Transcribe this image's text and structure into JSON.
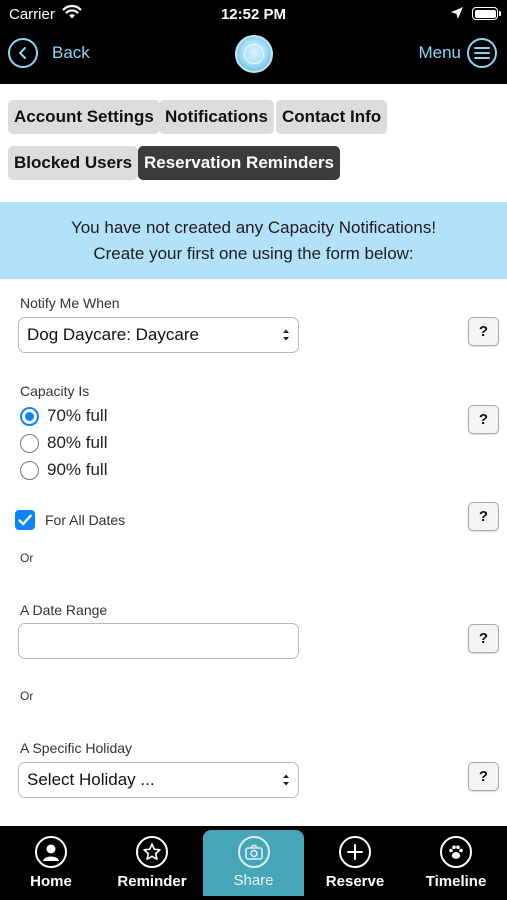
{
  "status_bar": {
    "carrier": "Carrier",
    "time": "12:52 PM"
  },
  "nav": {
    "back_label": "Back",
    "menu_label": "Menu"
  },
  "tabs": [
    {
      "label": "Account Settings",
      "active": false
    },
    {
      "label": "Notifications",
      "active": false
    },
    {
      "label": "Contact Info",
      "active": false
    },
    {
      "label": "Blocked Users",
      "active": false
    },
    {
      "label": "Reservation Reminders",
      "active": true
    }
  ],
  "banner": {
    "line1": "You have not created any Capacity Notifications!",
    "line2": "Create your first one using the form below:"
  },
  "form": {
    "notify_label": "Notify Me When",
    "notify_value": "Dog Daycare: Daycare",
    "capacity_label": "Capacity Is",
    "capacity_options": [
      {
        "label": "70% full",
        "selected": true
      },
      {
        "label": "80% full",
        "selected": false
      },
      {
        "label": "90% full",
        "selected": false
      }
    ],
    "all_dates_label": "For All Dates",
    "all_dates_checked": true,
    "or_1": "Or",
    "date_range_label": "A Date Range",
    "date_range_value": "",
    "or_2": "Or",
    "holiday_label": "A Specific Holiday",
    "holiday_value": "Select Holiday ...",
    "help_label": "?"
  },
  "bottom_nav": [
    {
      "label": "Home",
      "icon": "person-icon"
    },
    {
      "label": "Reminder",
      "icon": "star-icon"
    },
    {
      "label": "Share",
      "icon": "camera-icon",
      "active": true
    },
    {
      "label": "Reserve",
      "icon": "plus-icon"
    },
    {
      "label": "Timeline",
      "icon": "paw-icon"
    }
  ],
  "colors": {
    "accent": "#8fd3f5",
    "banner": "#b3e1f9",
    "active_tab": "#3c3c3c",
    "share_tab": "#46a5b6",
    "control_blue": "#0a84ff"
  }
}
